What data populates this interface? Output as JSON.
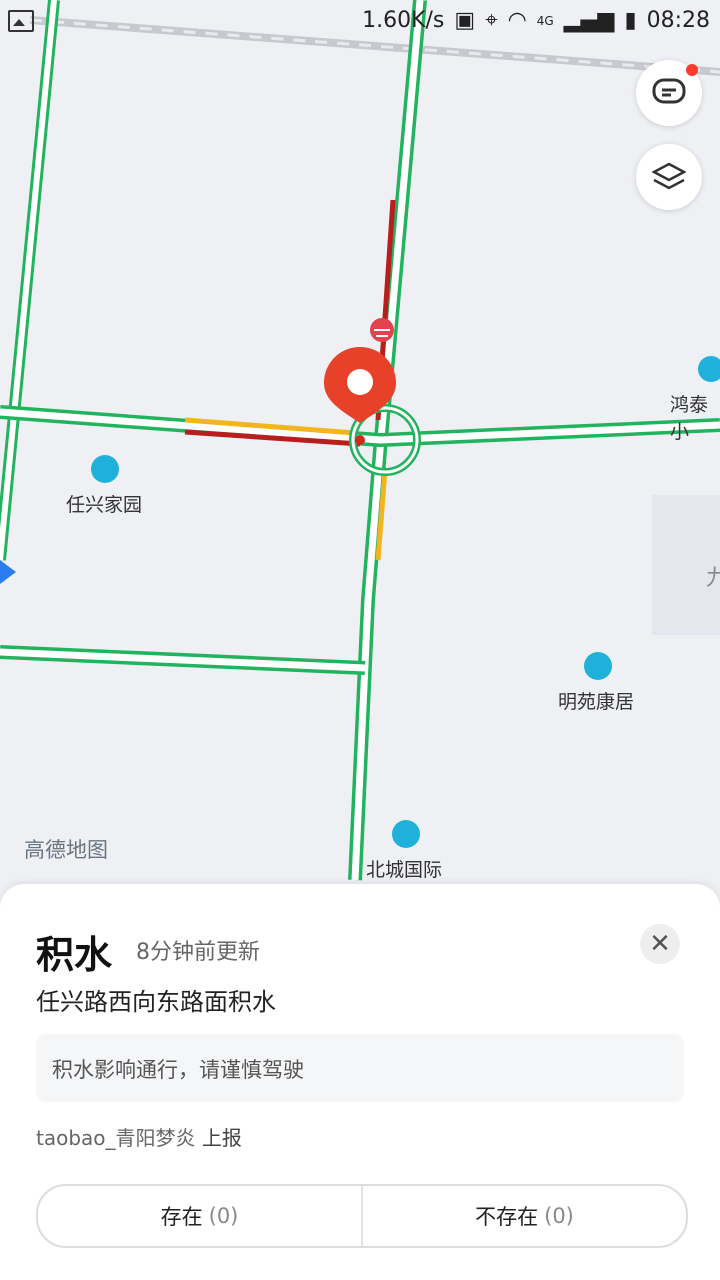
{
  "status_bar": {
    "network_speed": "1.60K/s",
    "signal": "4G",
    "time": "08:28"
  },
  "map": {
    "pois": [
      {
        "label": "任兴家园"
      },
      {
        "label": "明苑康居"
      },
      {
        "label": "北城国际"
      },
      {
        "label": "鸿泰小"
      }
    ],
    "watermark": "高德地图",
    "clipped_label": "九"
  },
  "sheet": {
    "title": "积水",
    "updated": "8分钟前更新",
    "description": "任兴路西向东路面积水",
    "notice": "积水影响通行，请谨慎驾驶",
    "reporter": "taobao_青阳梦炎",
    "reporter_suffix": "上报",
    "close_icon": "close-icon",
    "exists_button": {
      "label": "存在",
      "count": "(0)"
    },
    "not_exists_button": {
      "label": "不存在",
      "count": "(0)"
    }
  },
  "colors": {
    "road_green": "#22b35e",
    "road_red": "#b81e1e",
    "road_yellow": "#f2b51d",
    "pin_red": "#e8412a",
    "poi_blue": "#1fb1da"
  }
}
